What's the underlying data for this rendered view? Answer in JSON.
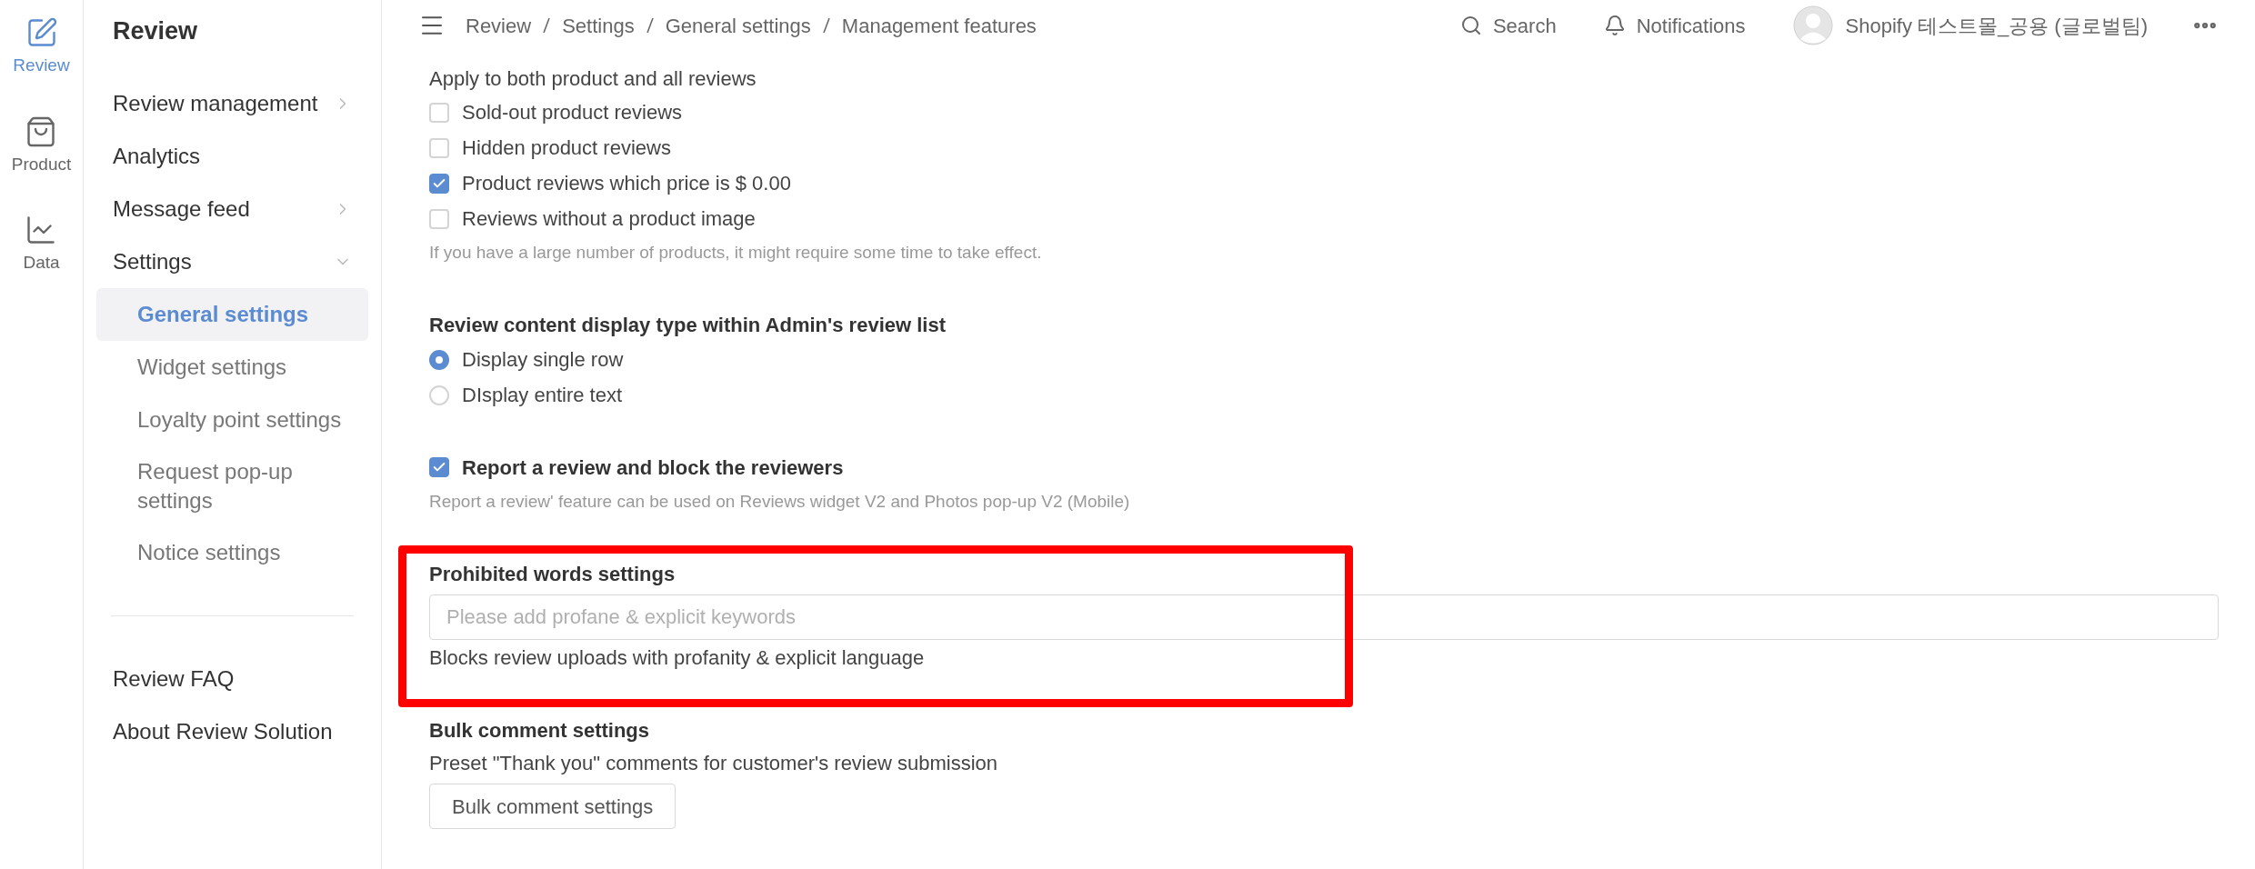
{
  "rail": [
    {
      "label": "Review",
      "selected": true
    },
    {
      "label": "Product",
      "selected": false
    },
    {
      "label": "Data",
      "selected": false
    }
  ],
  "sidebar": {
    "title": "Review",
    "items": [
      {
        "label": "Review management",
        "expanded": false
      },
      {
        "label": "Analytics"
      },
      {
        "label": "Message feed",
        "expanded": false
      },
      {
        "label": "Settings",
        "expanded": true,
        "children": [
          {
            "label": "General settings",
            "selected": true
          },
          {
            "label": "Widget settings",
            "selected": false
          },
          {
            "label": "Loyalty point settings",
            "selected": false
          },
          {
            "label": "Request pop-up settings",
            "selected": false
          },
          {
            "label": "Notice settings",
            "selected": false
          }
        ]
      }
    ],
    "links": [
      "Review FAQ",
      "About Review Solution"
    ]
  },
  "topbar": {
    "breadcrumb": [
      "Review",
      "Settings",
      "General settings",
      "Management features"
    ],
    "search": "Search",
    "notifications": "Notifications",
    "account": "Shopify 테스트몰_공용 (글로벌팀)"
  },
  "apply_group": {
    "label": "Apply to both product and all reviews",
    "options": [
      {
        "label": "Sold-out product reviews",
        "checked": false
      },
      {
        "label": "Hidden product reviews",
        "checked": false
      },
      {
        "label": "Product reviews which price is $ 0.00",
        "checked": true
      },
      {
        "label": "Reviews without a product image",
        "checked": false
      }
    ],
    "hint": "If you have a large number of products, it might require some time to take effect."
  },
  "display_type": {
    "title": "Review content display type within Admin's review list",
    "options": [
      {
        "label": "Display single row",
        "selected": true
      },
      {
        "label": "DIsplay entire text",
        "selected": false
      }
    ]
  },
  "report": {
    "label": "Report a review and block the reviewers",
    "checked": true,
    "hint": "Report a review' feature can be used on Reviews widget V2 and Photos pop-up V2 (Mobile)"
  },
  "prohibited_words": {
    "title": "Prohibited words settings",
    "placeholder": "Please add profane & explicit keywords",
    "description": "Blocks review uploads with profanity & explicit language",
    "highlighted": true
  },
  "bulk_comment": {
    "title": "Bulk comment settings",
    "description": "Preset \"Thank you\" comments for customer's review submission",
    "button": "Bulk comment settings"
  }
}
